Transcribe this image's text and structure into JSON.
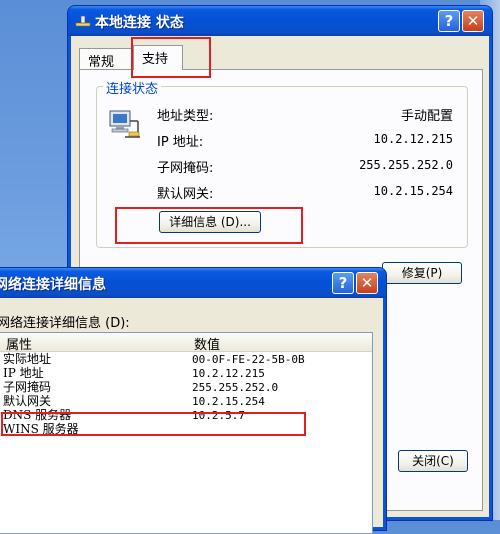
{
  "status_window": {
    "title": "本地连接 状态",
    "help_glyph": "?",
    "close_glyph": "✕",
    "tabs": [
      {
        "label": "常规"
      },
      {
        "label": "支持"
      }
    ],
    "group_title": "连接状态",
    "fields": [
      {
        "label": "地址类型:",
        "value": "手动配置"
      },
      {
        "label": "IP 地址:",
        "value": "10.2.12.215"
      },
      {
        "label": "子网掩码:",
        "value": "255.255.252.0"
      },
      {
        "label": "默认网关:",
        "value": "10.2.15.254"
      }
    ],
    "details_button": "详细信息 (D)...",
    "repair_button": "修复(P)",
    "close_button": "关闭(C)"
  },
  "details_window": {
    "title": "网络连接详细信息",
    "help_glyph": "?",
    "close_glyph": "✕",
    "caption": "网络连接详细信息 (D):",
    "columns": [
      "属性",
      "数值"
    ],
    "rows": [
      {
        "property": "实际地址",
        "value": "00-0F-FE-22-5B-0B"
      },
      {
        "property": "IP 地址",
        "value": "10.2.12.215"
      },
      {
        "property": "子网掩码",
        "value": "255.255.252.0"
      },
      {
        "property": "默认网关",
        "value": "10.2.15.254"
      },
      {
        "property": "DNS 服务器",
        "value": "10.2.5.7"
      },
      {
        "property": "WINS 服务器",
        "value": ""
      }
    ]
  },
  "colors": {
    "title_blue": "#0450d6",
    "dialog_face": "#ece9d8",
    "highlight_red": "#e02020",
    "group_title_blue": "#0046d5"
  }
}
